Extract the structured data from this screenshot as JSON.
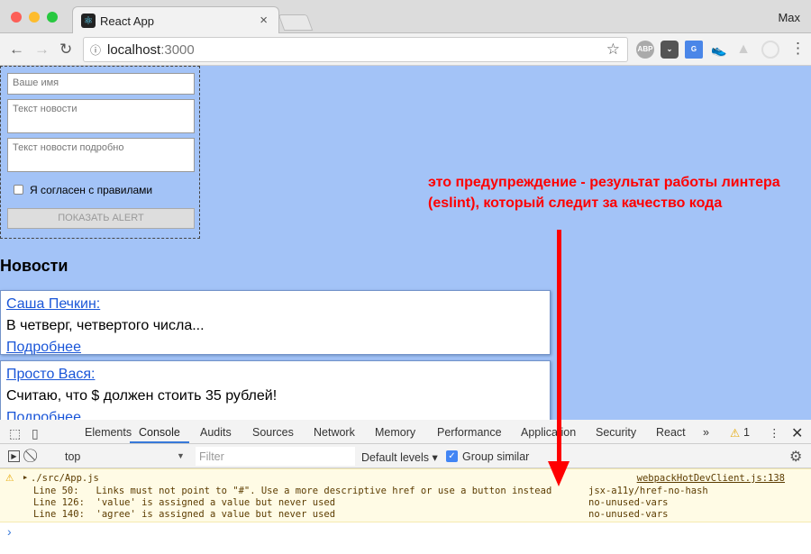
{
  "browser": {
    "tab_title": "React App",
    "user": "Max",
    "url_host": "localhost",
    "url_port": ":3000",
    "extensions": [
      "ABP",
      "pocket",
      "G",
      "sneaker",
      "drive",
      "circle"
    ]
  },
  "form": {
    "name_placeholder": "Ваше имя",
    "text_placeholder": "Текст новости",
    "bigtext_placeholder": "Текст новости подробно",
    "agree_label": "Я согласен с правилами",
    "alert_button": "ПОКАЗАТЬ ALERT"
  },
  "news": {
    "heading": "Новости",
    "items": [
      {
        "author": "Саша Печкин:",
        "text": "В четверг, четвертого числа...",
        "more": "Подробнее"
      },
      {
        "author": "Просто Вася:",
        "text": "Считаю, что $ должен стоить 35 рублей!",
        "more": "Подробнее"
      }
    ]
  },
  "annotation": "это предупреждение - результат работы линтера (eslint), который следит за качество кода",
  "devtools": {
    "tabs": [
      "Elements",
      "Console",
      "Audits",
      "Sources",
      "Network",
      "Memory",
      "Performance",
      "Application",
      "Security",
      "React"
    ],
    "active_tab": "Console",
    "more": "»",
    "warning_count": "1",
    "context": "top",
    "filter_placeholder": "Filter",
    "levels": "Default levels ▾",
    "group_similar": "Group similar",
    "warning": {
      "file": "./src/App.js",
      "source": "webpackHotDevClient.js:138",
      "lines": [
        {
          "text": "Line 50:   Links must not point to \"#\". Use a more descriptive href or use a button instead",
          "rule": "jsx-a11y/href-no-hash"
        },
        {
          "text": "Line 126:  'value' is assigned a value but never used",
          "rule": "no-unused-vars"
        },
        {
          "text": "Line 140:  'agree' is assigned a value but never used",
          "rule": "no-unused-vars"
        }
      ]
    },
    "prompt": "›"
  },
  "colors": {
    "page_bg": "#a3c3f7",
    "annotation": "#ff0000",
    "link": "#1a56d8"
  }
}
